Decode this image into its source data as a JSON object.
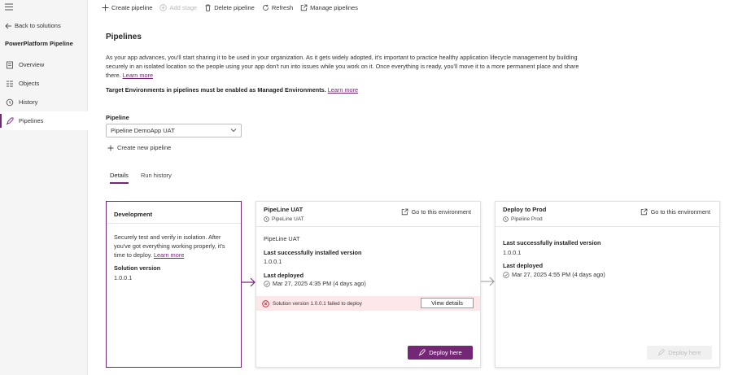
{
  "colors": {
    "accent": "#742774",
    "error_bg": "#fde7e9"
  },
  "sidebar": {
    "back_label": "Back to solutions",
    "solution_title": "PowerPlatform Pipeline",
    "items": [
      {
        "label": "Overview",
        "icon": "overview-icon"
      },
      {
        "label": "Objects",
        "icon": "objects-icon"
      },
      {
        "label": "History",
        "icon": "history-icon"
      },
      {
        "label": "Pipelines",
        "icon": "rocket-icon",
        "active": true
      }
    ]
  },
  "toolbar": {
    "create_pipeline": "Create pipeline",
    "add_stage": "Add stage",
    "delete_pipeline": "Delete pipeline",
    "refresh": "Refresh",
    "manage_pipelines": "Manage pipelines"
  },
  "page": {
    "title": "Pipelines",
    "intro": "As your app advances, you'll start sharing it to be used in your organization. As it gets widely adopted, it's important to practice healthy application lifecycle management by building securely in an isolated location so the people using your app don't run into issues while you work on it. Once everything is ready, you'll move it to a more permanent place and share there.",
    "intro_link": "Learn more",
    "target_text": "Target Environments in pipelines must be enabled as Managed Environments.",
    "target_link": "Learn more",
    "pipeline_label": "Pipeline",
    "pipeline_selected": "Pipeline DemoApp UAT",
    "create_new_pipeline": "Create new pipeline",
    "tabs": [
      "Details",
      "Run history"
    ]
  },
  "stages": {
    "dev": {
      "title": "Development",
      "description": "Securely test and verify in isolation. After you've got everything working properly, it's time to deploy.",
      "link": "Learn more",
      "version_label": "Solution version",
      "version": "1.0.0.1"
    },
    "uat": {
      "title": "PipeLine UAT",
      "env": "PipeLine UAT",
      "goto": "Go to this environment",
      "name": "PipeLine UAT",
      "installed_label": "Last successfully installed version",
      "installed": "1.0.0.1",
      "deployed_label": "Last deployed",
      "deployed": "Mar 27, 2025 4:35 PM (4 days ago)",
      "error": "Solution version 1.0.0.1 failed to deploy",
      "view_details": "View details",
      "deploy": "Deploy here"
    },
    "prod": {
      "title": "Deploy to Prod",
      "env": "Pipeline Prod",
      "goto": "Go to this environment",
      "installed_label": "Last successfully installed version",
      "installed": "1.0.0.1",
      "deployed_label": "Last deployed",
      "deployed": "Mar 27, 2025 4:55 PM (4 days ago)",
      "deploy": "Deploy here"
    }
  }
}
